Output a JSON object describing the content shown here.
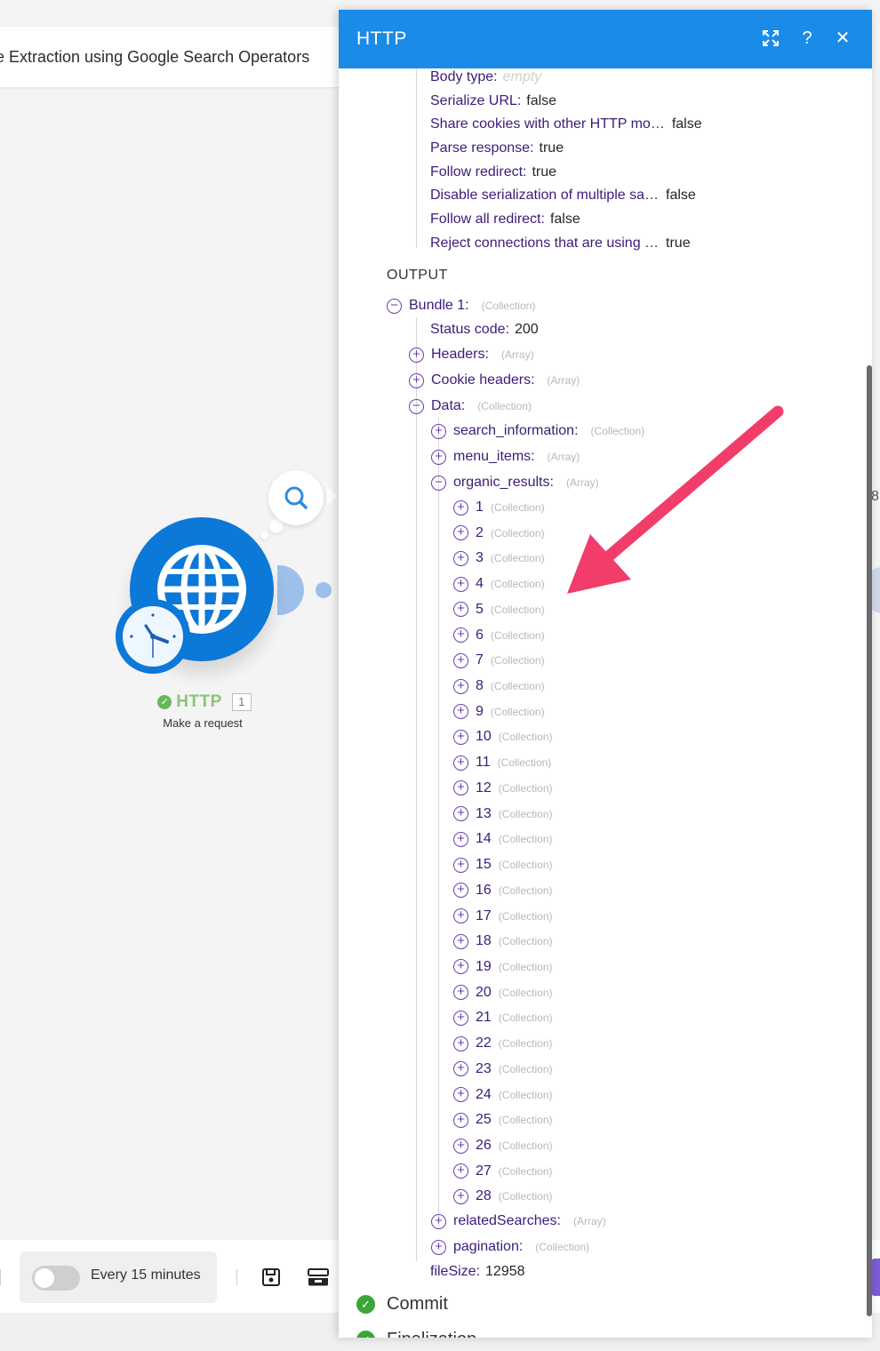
{
  "canvas": {
    "scenario_title": "e Extraction using Google Search Operators",
    "module": {
      "name": "HTTP",
      "count": "1",
      "subtitle": "Make a request",
      "icon": "globe-icon"
    },
    "right_partial_number": "8"
  },
  "bottom_bar": {
    "schedule_label": "Every 15 minutes",
    "toggle_on": false
  },
  "panel": {
    "title": "HTTP",
    "header_icons": [
      "expand-icon",
      "help-icon",
      "close-icon"
    ],
    "input_rows": [
      {
        "key": "Body type",
        "value": "empty"
      },
      {
        "key": "Serialize URL",
        "value": "false"
      },
      {
        "key": "Share cookies with other HTTP mo…",
        "value": "false"
      },
      {
        "key": "Parse response",
        "value": "true"
      },
      {
        "key": "Follow redirect",
        "value": "true"
      },
      {
        "key": "Disable serialization of multiple sa…",
        "value": "false"
      },
      {
        "key": "Follow all redirect",
        "value": "false"
      },
      {
        "key": "Reject connections that are using …",
        "value": "true"
      }
    ],
    "output_label": "OUTPUT",
    "bundle": {
      "key": "Bundle 1",
      "type": "(Collection)",
      "toggle": "−"
    },
    "bundle_children": [
      {
        "key": "Status code",
        "value": "200"
      },
      {
        "key": "Headers",
        "type": "(Array)",
        "toggle": "+"
      },
      {
        "key": "Cookie headers",
        "type": "(Array)",
        "toggle": "+"
      },
      {
        "key": "Data",
        "type": "(Collection)",
        "toggle": "−"
      }
    ],
    "data_children": [
      {
        "key": "search_information",
        "type": "(Collection)",
        "toggle": "+"
      },
      {
        "key": "menu_items",
        "type": "(Array)",
        "toggle": "+"
      },
      {
        "key": "organic_results",
        "type": "(Array)",
        "toggle": "−"
      }
    ],
    "organic_results": [
      {
        "key": "1",
        "type": "(Collection)"
      },
      {
        "key": "2",
        "type": "(Collection)"
      },
      {
        "key": "3",
        "type": "(Collection)"
      },
      {
        "key": "4",
        "type": "(Collection)"
      },
      {
        "key": "5",
        "type": "(Collection)"
      },
      {
        "key": "6",
        "type": "(Collection)"
      },
      {
        "key": "7",
        "type": "(Collection)"
      },
      {
        "key": "8",
        "type": "(Collection)"
      },
      {
        "key": "9",
        "type": "(Collection)"
      },
      {
        "key": "10",
        "type": "(Collection)"
      },
      {
        "key": "11",
        "type": "(Collection)"
      },
      {
        "key": "12",
        "type": "(Collection)"
      },
      {
        "key": "13",
        "type": "(Collection)"
      },
      {
        "key": "14",
        "type": "(Collection)"
      },
      {
        "key": "15",
        "type": "(Collection)"
      },
      {
        "key": "16",
        "type": "(Collection)"
      },
      {
        "key": "17",
        "type": "(Collection)"
      },
      {
        "key": "18",
        "type": "(Collection)"
      },
      {
        "key": "19",
        "type": "(Collection)"
      },
      {
        "key": "20",
        "type": "(Collection)"
      },
      {
        "key": "21",
        "type": "(Collection)"
      },
      {
        "key": "22",
        "type": "(Collection)"
      },
      {
        "key": "23",
        "type": "(Collection)"
      },
      {
        "key": "24",
        "type": "(Collection)"
      },
      {
        "key": "25",
        "type": "(Collection)"
      },
      {
        "key": "26",
        "type": "(Collection)"
      },
      {
        "key": "27",
        "type": "(Collection)"
      },
      {
        "key": "28",
        "type": "(Collection)"
      }
    ],
    "data_tail": [
      {
        "key": "relatedSearches",
        "type": "(Array)",
        "toggle": "+"
      },
      {
        "key": "pagination",
        "type": "(Collection)",
        "toggle": "+"
      }
    ],
    "file_size": {
      "key": "fileSize",
      "value": "12958"
    },
    "statuses": [
      {
        "label": "Commit"
      },
      {
        "label": "Finalization"
      }
    ]
  },
  "colors": {
    "panel_header": "#1a8be6",
    "key_text": "#3b1c7a",
    "toggle_icon": "#6a3fb0",
    "annotation_arrow": "#f23c6a",
    "status_check": "#3aa63a",
    "module_blue": "#0c78d8"
  }
}
